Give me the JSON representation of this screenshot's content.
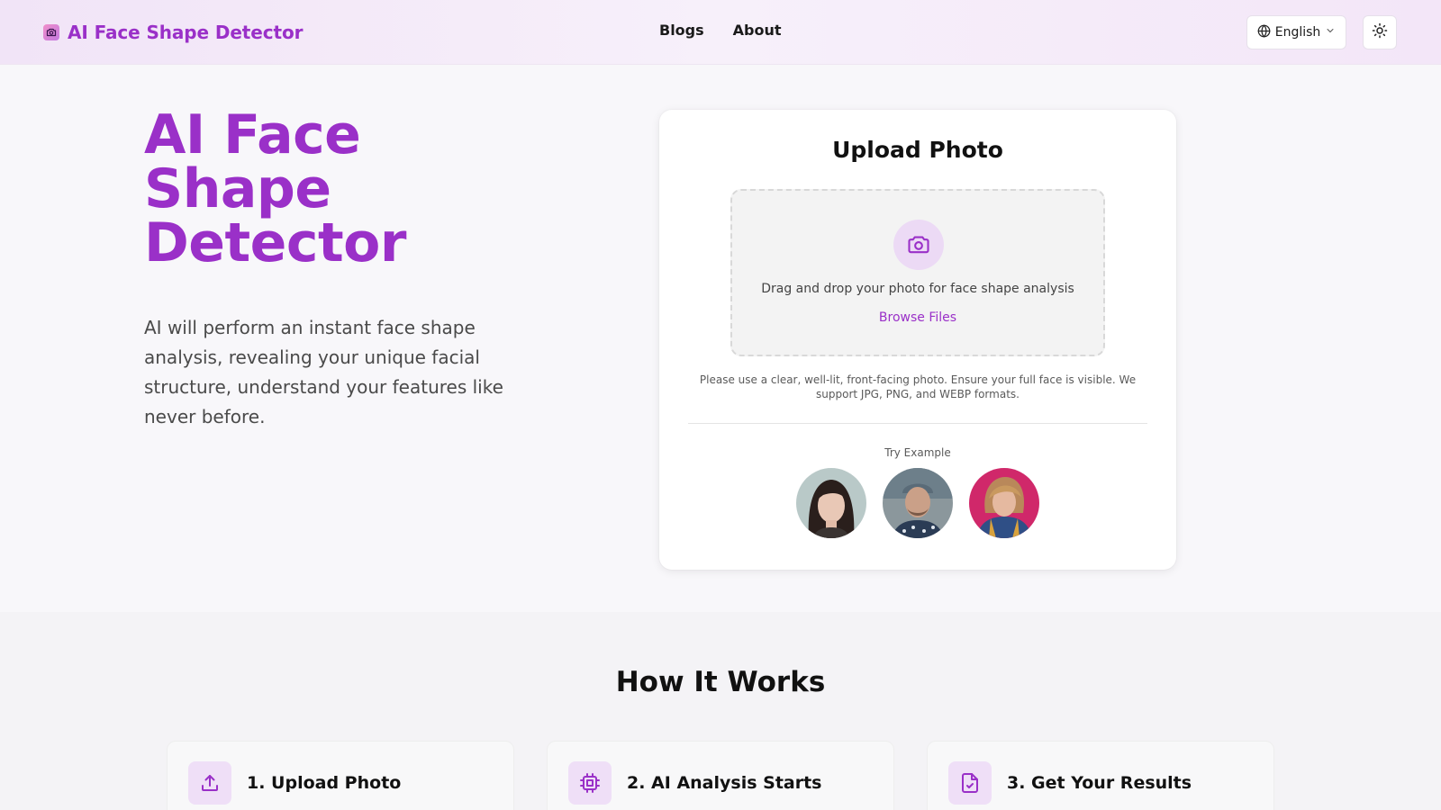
{
  "header": {
    "logo_text": "AI Face Shape Detector",
    "logo_icon": "camera-icon",
    "nav": [
      {
        "label": "Blogs"
      },
      {
        "label": "About"
      }
    ],
    "language": "English",
    "theme_icon": "sun-icon"
  },
  "hero": {
    "title": "AI Face Shape Detector",
    "description": "AI will perform an instant face shape analysis, revealing your unique facial structure, understand your features like never before."
  },
  "upload": {
    "title": "Upload Photo",
    "drop_text": "Drag and drop your photo for face shape analysis",
    "browse_label": "Browse Files",
    "hint": "Please use a clear, well-lit, front-facing photo. Ensure your full face is visible. We support JPG, PNG, and WEBP formats.",
    "try_example_label": "Try Example"
  },
  "how_it_works": {
    "title": "How It Works",
    "steps": [
      {
        "title": "1. Upload Photo",
        "icon": "upload-icon"
      },
      {
        "title": "2. AI Analysis Starts",
        "icon": "cpu-icon"
      },
      {
        "title": "3. Get Your Results",
        "icon": "file-check-icon"
      }
    ]
  },
  "colors": {
    "accent": "#9a30c8",
    "accent_soft": "#ecdaf5"
  }
}
